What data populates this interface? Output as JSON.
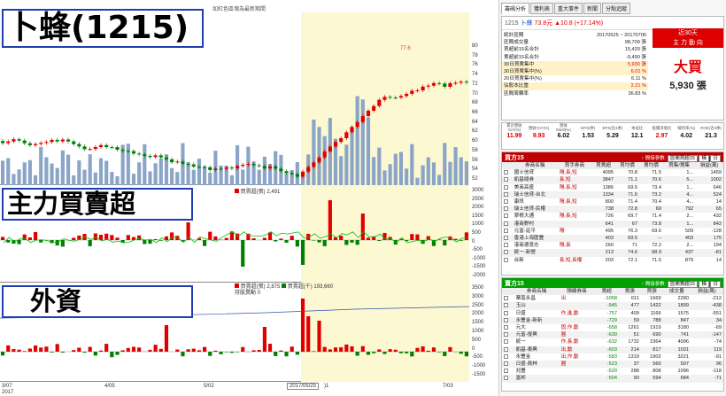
{
  "left": {
    "caption": "如紅色區塊為最新期間",
    "title_price": "卜蜂(1215)",
    "title_main": "主力買賣超",
    "title_foreign": "外資",
    "legend_main": "買賣超(張) 2,491",
    "legend_foreign_a": "買賣超(張) 2,875",
    "legend_foreign_b": "買賣超(千) 193,660",
    "legend_foreign_c": "持股異動 0",
    "price_marker": "77.6",
    "price_axis": [
      "80",
      "78",
      "76",
      "74",
      "72",
      "70",
      "68",
      "66",
      "64",
      "62",
      "60",
      "58",
      "56",
      "54",
      "52"
    ],
    "main_axis": [
      "3000",
      "2500",
      "2000",
      "1500",
      "1000",
      "500",
      "0",
      "-500",
      "-1000",
      "-1500",
      "-2000"
    ],
    "foreign_axis": [
      "3500",
      "3000",
      "2500",
      "2000",
      "1500",
      "1000",
      "500",
      "0",
      "-500",
      "-1000",
      "-1500"
    ],
    "dates": [
      "3/07",
      "4/05",
      "5/02",
      "7/03"
    ],
    "year": "2017",
    "cursor_date": "2017/05/25",
    "cursor_suffix": ")1"
  },
  "right": {
    "tabs": [
      "籌碼分析",
      "獲利表",
      "重大事件",
      "新聞",
      "分點追蹤"
    ],
    "stock": {
      "code": "1215",
      "name": "卜蜂",
      "price": "73.8元",
      "change": "▲10.8 (+17.14%)"
    },
    "summary": [
      {
        "label": "統計區間",
        "value": "20170525 ~ 20170706",
        "red": false
      },
      {
        "label": "區間成交量",
        "value": "98,709 張",
        "red": false
      },
      {
        "label": "買超前15名合計",
        "value": "15,420 張",
        "red": false
      },
      {
        "label": "賣超前15名合計",
        "value": "-9,490 張",
        "red": false
      },
      {
        "label": "30日買賣集中",
        "value": "5,930 張",
        "red": true
      },
      {
        "label": "30日買賣集中(%)",
        "value": "6.01 %",
        "red": true
      },
      {
        "label": "20日買賣集中(%)",
        "value": "6.11 %",
        "red": false
      },
      {
        "label": "佔股本比重",
        "value": "2.21 %",
        "red": true
      },
      {
        "label": "區間周轉率",
        "value": "36.83 %",
        "red": false
      }
    ],
    "near30": "近30天",
    "main_dir": "主 力 動 向",
    "verdict": "大買",
    "verdict_qty": "5,930 張",
    "fin_head": [
      "累計營收YoY(%)",
      "營收YoY(%)",
      "營收MoM(%)",
      "EPS(季)",
      "EPS(近4季)",
      "本益比",
      "股價淨值比",
      "殖利率(%)",
      "ROE(近4季)"
    ],
    "fin_vals": [
      "11.99",
      "9.93",
      "6.02",
      "1.53",
      "5.29",
      "12.1",
      "2.97",
      "4.02",
      "21.3"
    ],
    "buy_title": "買方15",
    "buy_ref": "↑ 間接參數:",
    "buy_select": "區間買超15",
    "sell_title": "賣方15",
    "sell_ref": "↑ 間接參數:",
    "sell_select": "區間賣超15",
    "btn_a": "橫",
    "btn_b": "日",
    "buy_cols": [
      "券商名稱",
      "買手券商",
      "買賣超",
      "買均價",
      "賣均價",
      "買集/賣集",
      "損益(萬)"
    ],
    "buy_rows": [
      [
        "國士信貸",
        "隔,長,短",
        "4095",
        "70.8",
        "71.5",
        "1...",
        "1459"
      ],
      [
        "凱基總券",
        "長,短",
        "3847",
        "71.1",
        "70.6",
        "5...",
        "1002"
      ],
      [
        "美商高盛",
        "隔,長,短",
        "1386",
        "69.5",
        "73.4",
        "1...",
        "646"
      ],
      [
        "瑞士信貸-台北",
        "",
        "1334",
        "71.6",
        "73.2",
        "4...",
        "524"
      ],
      [
        "康訊",
        "隔,長,短",
        "800",
        "71.4",
        "70.4",
        "4...",
        "14"
      ],
      [
        "瑞士信貸-民權",
        "",
        "738",
        "72.8",
        "69",
        "792",
        "65"
      ],
      [
        "摩根大通",
        "隔,長,短",
        "726",
        "69.7",
        "71.4",
        "2...",
        "432"
      ],
      [
        "港商野村",
        "",
        "641",
        "67",
        "73.8",
        "1...",
        "842"
      ],
      [
        "元富-延平",
        "隔",
        "495",
        "76.3",
        "69.6",
        "509",
        "-128"
      ],
      [
        "香港上海匯豐",
        "",
        "403",
        "69.5",
        "--",
        "403",
        "175"
      ],
      [
        "港商德意志",
        "隔,長",
        "260",
        "71",
        "72.2",
        "2...",
        "194"
      ],
      [
        "統一-新營",
        "",
        "213",
        "74.6",
        "68.9",
        "437",
        "-81"
      ],
      [
        "台新",
        "長,短,長權",
        "203",
        "72.1",
        "71.5",
        "879",
        "14"
      ]
    ],
    "sell_cols": [
      "券商名稱",
      "隔線券商",
      "賣超",
      "賣張",
      "買張",
      "成交量",
      "損益(萬)"
    ],
    "sell_rows": [
      [
        "華南永昌",
        "出",
        "-1058",
        "611",
        "1669",
        "2280",
        "-212"
      ],
      [
        "玉山",
        "",
        "-945",
        "477",
        "1422",
        "1899",
        "-438"
      ],
      [
        "日盛",
        "作,進,動",
        "-757",
        "409",
        "1166",
        "1575",
        "-551"
      ],
      [
        "永豐金-新新",
        "",
        "-729",
        "59",
        "788",
        "847",
        "34"
      ],
      [
        "元大",
        "固,作,動",
        "-658",
        "1261",
        "1919",
        "3180",
        "-69"
      ],
      [
        "元富-復興",
        "圓",
        "-639",
        "51",
        "690",
        "741",
        "-147"
      ],
      [
        "統一",
        "作,長,動",
        "-632",
        "1732",
        "2364",
        "4096",
        "-74"
      ],
      [
        "凱基-東興",
        "出,動",
        "-603",
        "214",
        "817",
        "1031",
        "119"
      ],
      [
        "永豐金",
        "出,作,動",
        "-583",
        "1319",
        "1902",
        "3221",
        "-91"
      ],
      [
        "日盛-員林",
        "圓",
        "-523",
        "37",
        "560",
        "597",
        "96"
      ],
      [
        "兆豐",
        "",
        "-520",
        "288",
        "808",
        "1096",
        "-118"
      ],
      [
        "富邦",
        "",
        "-504",
        "90",
        "594",
        "684",
        "-71"
      ]
    ]
  },
  "colors": {
    "up": "#e00000",
    "down": "#008000",
    "bar": "#8ba5c8",
    "highlight": "#fbf8d2",
    "line": "#00c000",
    "buyhdr": "#c00000",
    "sellhdr": "#00a000"
  }
}
